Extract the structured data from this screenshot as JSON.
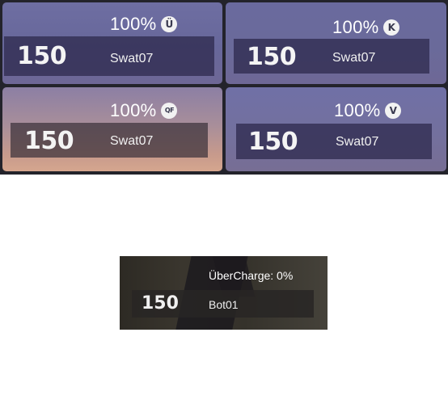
{
  "team_cards": [
    {
      "charge": "100%",
      "medigun_icon": "uber-icon",
      "medigun_glyph": "Ü",
      "health": "150",
      "player": "Swat07"
    },
    {
      "charge": "100%",
      "medigun_icon": "kritzkrieg-icon",
      "medigun_glyph": "K",
      "health": "150",
      "player": "Swat07"
    },
    {
      "charge": "100%",
      "medigun_icon": "quick-fix-icon",
      "medigun_glyph": "QF",
      "health": "150",
      "player": "Swat07"
    },
    {
      "charge": "100%",
      "medigun_icon": "vaccinator-icon",
      "medigun_glyph": "V",
      "health": "150",
      "player": "Swat07"
    }
  ],
  "target_panel": {
    "charge_label": "ÜberCharge: 0%",
    "health": "150",
    "player": "Bot01"
  }
}
